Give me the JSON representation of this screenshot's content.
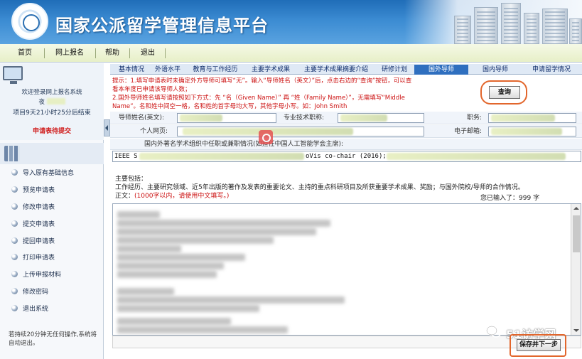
{
  "header": {
    "site_title": "国家公派留学管理信息平台"
  },
  "nav": {
    "items": [
      "首页",
      "网上报名",
      "帮助",
      "退出"
    ]
  },
  "sidebar": {
    "welcome_line1": "欢迎登录网上报名系统",
    "welcome_line2": "夜",
    "countdown": "项目9天21小时25分后结束",
    "status": "申请表待提交",
    "menu": [
      "导入原有基础信息",
      "预览申请表",
      "修改申请表",
      "提交申请表",
      "提回申请表",
      "打印申请表",
      "上传申报材料",
      "修改密码",
      "退出系统"
    ],
    "footer": "若持续20分钟无任何操作,系统将自动退出。"
  },
  "tabs": {
    "items": [
      "基本情况",
      "外语水平",
      "教育与工作经历",
      "主要学术成果",
      "主要学术成果摘要介绍",
      "研修计划",
      "国外导师",
      "国内导师",
      "申请留学情况"
    ],
    "active_index": 6
  },
  "hint": {
    "line1": "提示：1.填写申请表时未确定外方导师可填写“无”。输入“导师姓名（英文）”后，点击右边的“查询”按钮，可以查",
    "line2": "看本年度已申请该导师人数；",
    "line3": "2.国外导师姓名填写请按照如下方式：先 “名（Given Name）” 再 “姓（Family Name）”，无需填写“Middle",
    "line4": "Name”。名和姓中间空一格，名和姓的首字母均大写，其他字母小写。如：John Smith"
  },
  "query_button": "查询",
  "form": {
    "tutor_name_label": "导师姓名(英文):",
    "title_label": "专业技术职称:",
    "position_label": "职务:",
    "homepage_label": "个人网页:",
    "email_label": "电子邮箱:",
    "academic_label": "国内外著名学术组织中任职或兼职情况(如担任中国人工智能学会主席):",
    "academic_value_a": "IEEE S",
    "academic_value_b": "oVis co-chair (2016);"
  },
  "desc": {
    "heading": "主要包括：",
    "body": "工作经历、主要研究领域、近5年出版的著作及发表的重要论文、主持的重点科研项目及所获重要学术成果、奖励；与国外院校/导师的合作情况。",
    "text_prefix": "正文：",
    "text_limit": "(1000字以内，请使用中文填写。)",
    "count_prefix": "您已输入了：",
    "count_value": "999",
    "count_suffix": "字"
  },
  "save_button": "保存并下一步",
  "watermark": "51访学网",
  "colors": {
    "header_blue": "#2f7fc7",
    "active_tab": "#2f6fbf",
    "hint_red": "#cc1111",
    "highlight_ring": "#e2662c"
  },
  "icons": [
    "monitor-icon",
    "books-icon",
    "menu-bullet-icon",
    "collapse-arrow-icon",
    "wechat-icon"
  ]
}
